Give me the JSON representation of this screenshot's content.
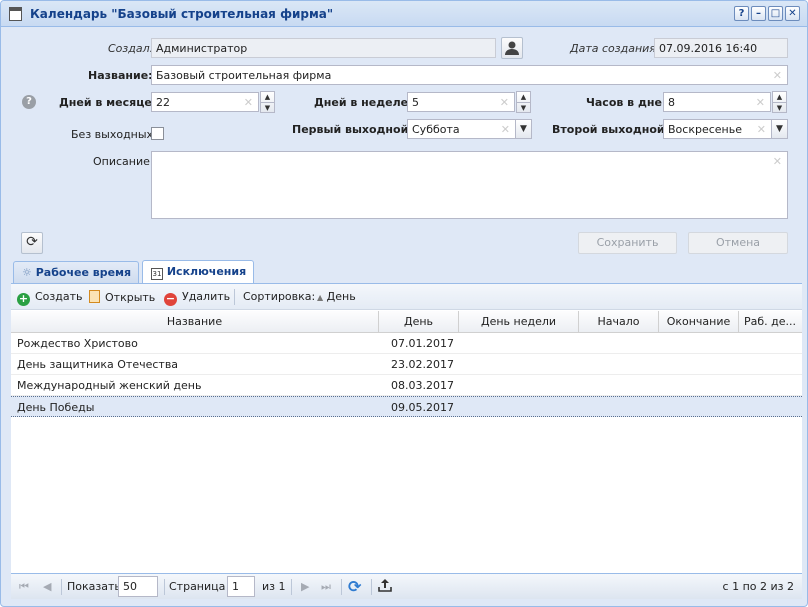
{
  "window": {
    "title": "Календарь \"Базовый строительная фирма\"",
    "buttons": [
      "?",
      "–",
      "□",
      "✕"
    ]
  },
  "form": {
    "created_by_label": "Создал:",
    "created_by_value": "Администратор",
    "created_date_label": "Дата создания:",
    "created_date_value": "07.09.2016 16:40",
    "name_label": "Название:",
    "name_value": "Базовый строительная фирма",
    "days_in_month_label": "Дней в месяце:",
    "days_in_month_value": "22",
    "days_in_week_label": "Дней в неделе:",
    "days_in_week_value": "5",
    "hours_in_day_label": "Часов в дне:",
    "hours_in_day_value": "8",
    "no_weekends_label": "Без выходных:",
    "first_weekend_label": "Первый выходной:",
    "first_weekend_value": "Суббота",
    "second_weekend_label": "Второй выходной:",
    "second_weekend_value": "Воскресенье",
    "description_label": "Описание:",
    "save_label": "Сохранить",
    "cancel_label": "Отмена"
  },
  "tabs": [
    {
      "label": "Рабочее время"
    },
    {
      "label": "Исключения"
    }
  ],
  "toolbar": {
    "create": "Создать",
    "open": "Открыть",
    "delete": "Удалить",
    "sort_label": "Сортировка:",
    "sort_value": "День"
  },
  "grid": {
    "columns": [
      "Название",
      "День",
      "День недели",
      "Начало",
      "Окончание",
      "Раб. де..."
    ],
    "rows": [
      {
        "name": "Рождество Христово",
        "day": "07.01.2017"
      },
      {
        "name": "День защитника Отечества",
        "day": "23.02.2017"
      },
      {
        "name": "Международный женский день",
        "day": "08.03.2017"
      },
      {
        "name": "День Победы",
        "day": "09.05.2017"
      }
    ]
  },
  "pager": {
    "show_label": "Показать",
    "page_size": "50",
    "page_label": "Страница",
    "page_value": "1",
    "of_pages": "из 1",
    "summary": "с 1 по 2 из 2"
  },
  "colors": {
    "accent": "#15428b",
    "border": "#99bbe8",
    "window_bg": "#dfe8f6",
    "create_icon": "#2aa043",
    "delete_icon": "#e0443a"
  }
}
